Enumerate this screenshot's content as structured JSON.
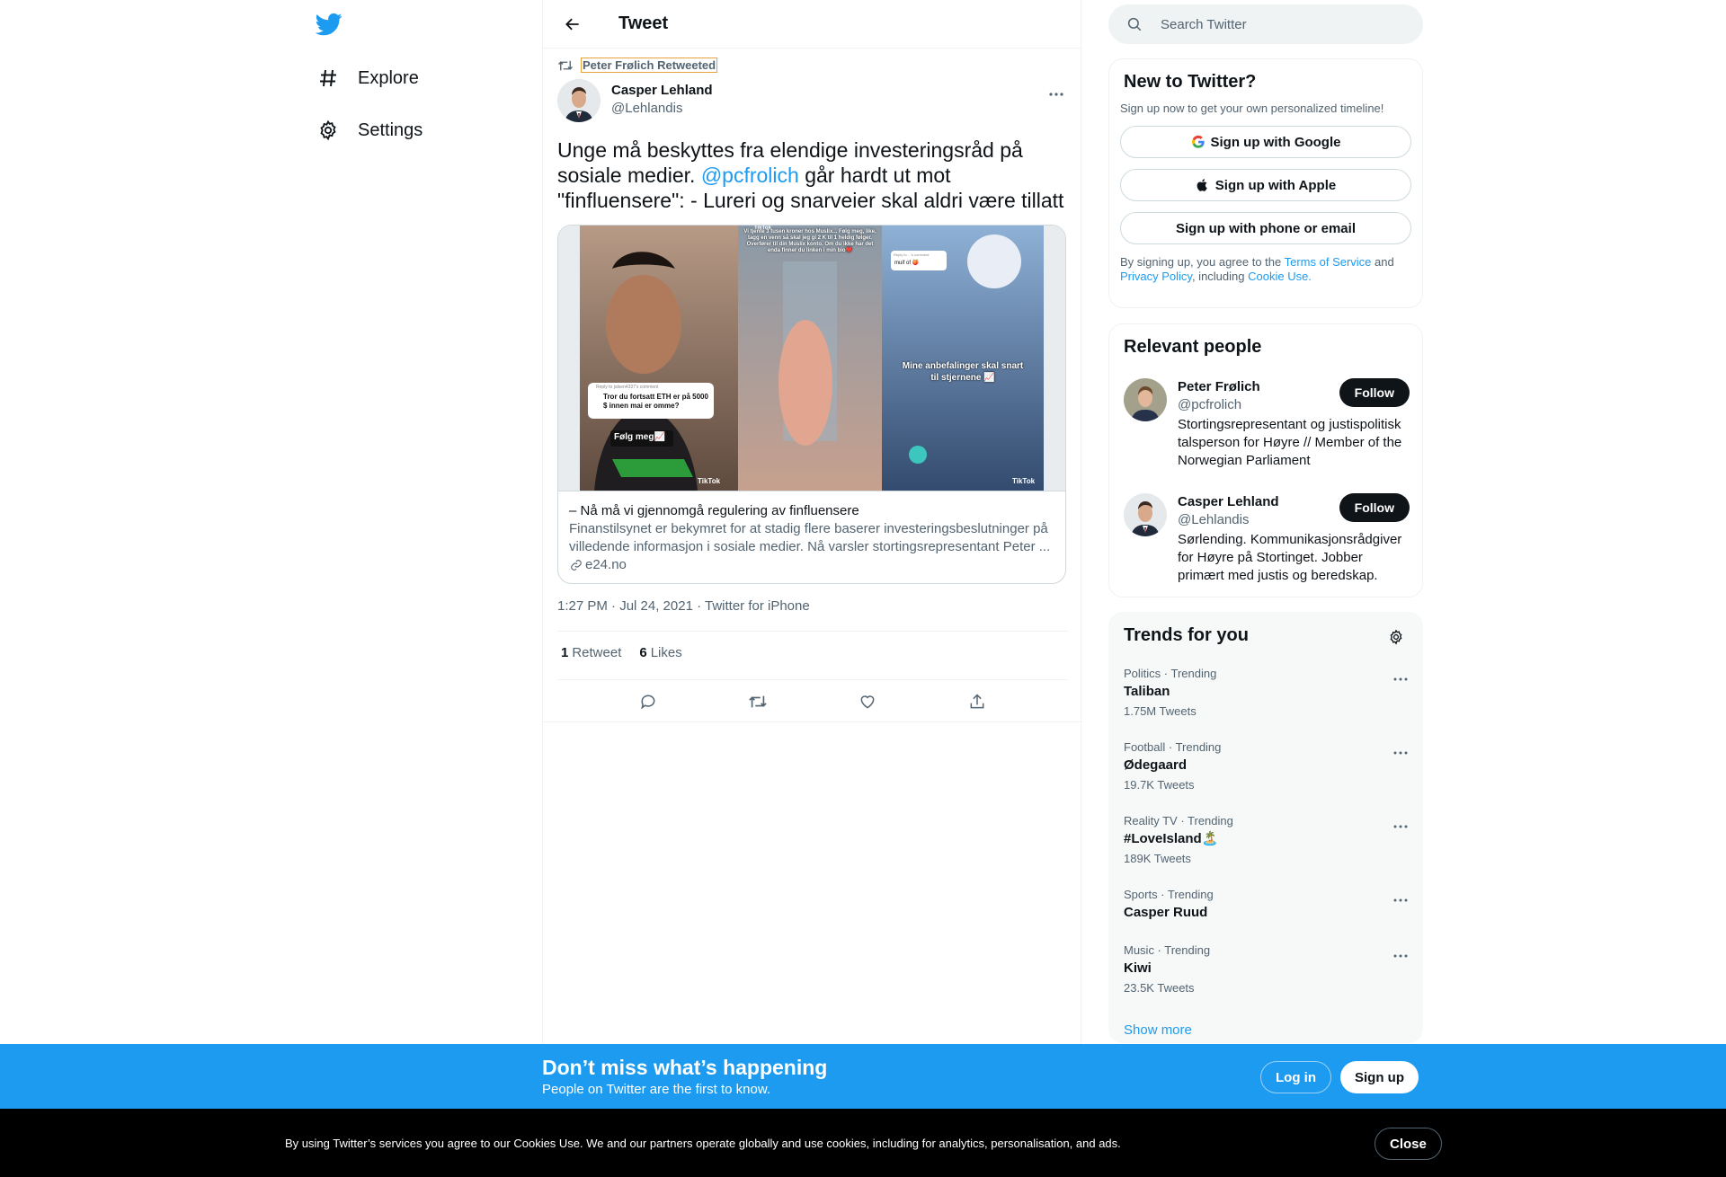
{
  "nav": {
    "logo": "twitter-bird-icon",
    "items": [
      {
        "label": "Explore",
        "icon": "hashtag-icon"
      },
      {
        "label": "Settings",
        "icon": "gear-icon"
      }
    ]
  },
  "header": {
    "title": "Tweet"
  },
  "tweet": {
    "retweeted_by": "Peter Frølich Retweeted",
    "author_name": "Casper Lehland",
    "author_handle": "@Lehlandis",
    "text_before": "Unge må beskyttes fra elendige investeringsråd på sosiale medier. ",
    "mention": "@pcfrolich",
    "text_after": " går hardt ut mot \"finfluensere\": - Lureri og snarveier skal aldri være tillatt",
    "card": {
      "title": "– Nå må vi gjennomgå regulering av finfluensere",
      "description": "Finanstilsynet er bekymret for at stadig flere baserer investeringsbeslutninger på villedende informasjon i sosiale medier. Nå varsler stortingsrepresentant Peter ...",
      "domain": "e24.no",
      "image_texts": {
        "bubble1_small": "Reply to jalsen4337's comment",
        "bubble1": "Tror du fortsatt ETH er på 5000 $ innen mai er omme?",
        "follow": "Følg meg📈",
        "brand1": "TikTok",
        "brand2": "TikTok",
        "top_brand": "TikTok",
        "overlay_mid": "Vi tjente 3 tusen kroner hos Muslix... Følg meg, like, tagg en venn så skal jeg gi 2 K til 1 heldig følger. Overfører til din Muslix konto. Om du ikke har det enda finner du linken i min bio❤️",
        "bubble3_small": "Reply to ...'s comment",
        "bubble3": "muif of 🍑",
        "overlay_right": "Mine anbefalinger skal snart til stjernene 📈"
      }
    },
    "timestamp": "1:27 PM · Jul 24, 2021 · Twitter for iPhone",
    "retweets_count": "1",
    "retweets_label": "Retweet",
    "likes_count": "6",
    "likes_label": "Likes"
  },
  "search": {
    "placeholder": "Search Twitter"
  },
  "signup": {
    "title": "New to Twitter?",
    "subtitle": "Sign up now to get your own personalized timeline!",
    "google": "Sign up with Google",
    "apple": "Sign up with Apple",
    "phone": "Sign up with phone or email",
    "terms_pre": "By signing up, you agree to the ",
    "terms_link": "Terms of Service",
    "terms_and": " and ",
    "privacy_link": "Privacy Policy",
    "terms_mid": ", including ",
    "cookie_link": "Cookie Use."
  },
  "people": {
    "title": "Relevant people",
    "list": [
      {
        "name": "Peter Frølich",
        "handle": "@pcfrolich",
        "bio": "Stortingsrepresentant og justispolitisk talsperson for Høyre // Member of the Norwegian Parliament",
        "follow": "Follow"
      },
      {
        "name": "Casper Lehland",
        "handle": "@Lehlandis",
        "bio": "Sørlending. Kommunikasjonsrådgiver for Høyre på Stortinget. Jobber primært med justis og beredskap.",
        "follow": "Follow"
      }
    ]
  },
  "trends": {
    "title": "Trends for you",
    "items": [
      {
        "category": "Politics · Trending",
        "name": "Taliban",
        "count": "1.75M Tweets"
      },
      {
        "category": "Football · Trending",
        "name": "Ødegaard",
        "count": "19.7K Tweets"
      },
      {
        "category": "Reality TV · Trending",
        "name": "#LoveIsland🏝️",
        "count": "189K Tweets"
      },
      {
        "category": "Sports · Trending",
        "name": "Casper Ruud",
        "count": ""
      },
      {
        "category": "Music · Trending",
        "name": "Kiwi",
        "count": "23.5K Tweets"
      }
    ],
    "show_more": "Show more"
  },
  "banner": {
    "title": "Don’t miss what’s happening",
    "subtitle": "People on Twitter are the first to know.",
    "login": "Log in",
    "signup": "Sign up"
  },
  "cookie": {
    "text": "By using Twitter’s services you agree to our Cookies Use. We and our partners operate globally and use cookies, including for analytics, personalisation, and ads.",
    "close": "Close"
  },
  "colors": {
    "accent": "#1d9bf0",
    "text": "#0f1419",
    "secondary": "#536471",
    "border": "#eff3f4"
  }
}
